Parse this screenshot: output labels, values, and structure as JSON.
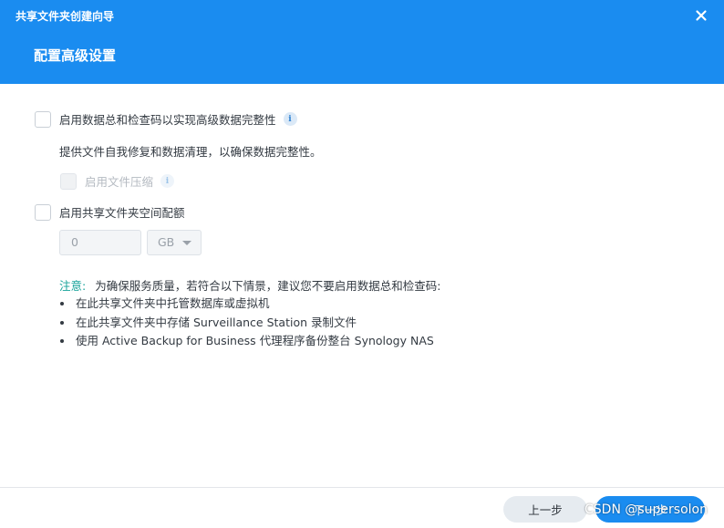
{
  "window": {
    "title": "共享文件夹创建向导",
    "step_title": "配置高级设置",
    "header_color": "#1a8cf0"
  },
  "options": {
    "checksum": {
      "label": "启用数据总和检查码以实现高级数据完整性",
      "checked": false,
      "description": "提供文件自我修复和数据清理，以确保数据完整性。"
    },
    "compression": {
      "label": "启用文件压缩",
      "checked": false,
      "disabled": true
    },
    "quota": {
      "label": "启用共享文件夹空间配额",
      "checked": false,
      "value": "0",
      "unit": "GB"
    }
  },
  "note": {
    "label": "注意:",
    "text": "为确保服务质量，若符合以下情景，建议您不要启用数据总和检查码:",
    "items": [
      "在此共享文件夹中托管数据库或虚拟机",
      "在此共享文件夹中存储 Surveillance Station 录制文件",
      "使用 Active Backup for Business 代理程序备份整台 Synology NAS"
    ]
  },
  "footer": {
    "prev_label": "上一步",
    "next_label": "下一步"
  },
  "watermark": "CSDN @supersolon",
  "icons": {
    "close": "close-icon",
    "info": "info-icon"
  }
}
